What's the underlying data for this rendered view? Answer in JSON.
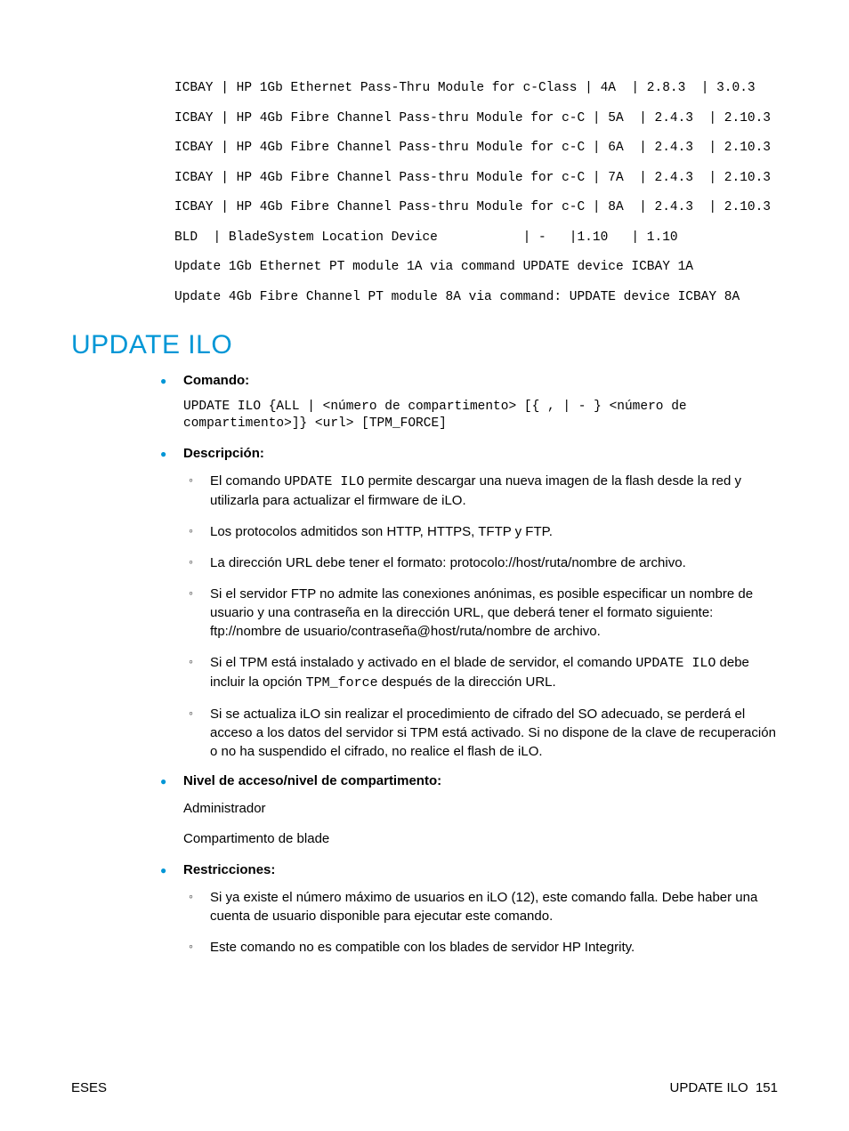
{
  "mono_lines": [
    "ICBAY | HP 1Gb Ethernet Pass-Thru Module for c-Class | 4A  | 2.8.3  | 3.0.3",
    "ICBAY | HP 4Gb Fibre Channel Pass-thru Module for c-C | 5A  | 2.4.3  | 2.10.3",
    "ICBAY | HP 4Gb Fibre Channel Pass-thru Module for c-C | 6A  | 2.4.3  | 2.10.3",
    "ICBAY | HP 4Gb Fibre Channel Pass-thru Module for c-C | 7A  | 2.4.3  | 2.10.3",
    "ICBAY | HP 4Gb Fibre Channel Pass-thru Module for c-C | 8A  | 2.4.3  | 2.10.3",
    "BLD  | BladeSystem Location Device           | -   |1.10   | 1.10",
    "Update 1Gb Ethernet PT module 1A via command UPDATE device ICBAY 1A",
    "Update 4Gb Fibre Channel PT module 8A via command: UPDATE device ICBAY 8A"
  ],
  "section_title": "UPDATE ILO",
  "bullets": {
    "comando": {
      "label": "Comando:",
      "syntax": "UPDATE ILO {ALL | <número de compartimento> [{ , | - } <número de compartimento>]} <url> [TPM_FORCE]"
    },
    "descripcion": {
      "label": "Descripción:",
      "items": {
        "d0_pre": "El comando ",
        "d0_code": "UPDATE ILO",
        "d0_post": " permite descargar una nueva imagen de la flash desde la red y utilizarla para actualizar el firmware de iLO.",
        "d1": "Los protocolos admitidos son HTTP, HTTPS, TFTP y FTP.",
        "d2": "La dirección URL debe tener el formato: protocolo://host/ruta/nombre de archivo.",
        "d3": "Si el servidor FTP no admite las conexiones anónimas, es posible especificar un nombre de usuario y una contraseña en la dirección URL, que deberá tener el formato siguiente: ftp://nombre de usuario/contraseña@host/ruta/nombre de archivo.",
        "d4_pre": "Si el TPM está instalado y activado en el blade de servidor, el comando ",
        "d4_code1": "UPDATE ILO",
        "d4_mid": " debe incluir la opción ",
        "d4_code2": "TPM_force",
        "d4_post": " después de la dirección URL.",
        "d5": "Si se actualiza iLO sin realizar el procedimiento de cifrado del SO adecuado, se perderá el acceso a los datos del servidor si TPM está activado. Si no dispone de la clave de recuperación o no ha suspendido el cifrado, no realice el flash de iLO."
      }
    },
    "nivel": {
      "label": "Nivel de acceso/nivel de compartimento:",
      "line1": "Administrador",
      "line2": "Compartimento de blade"
    },
    "restricciones": {
      "label": "Restricciones:",
      "items": {
        "r0": "Si ya existe el número máximo de usuarios en iLO (12), este comando falla. Debe haber una cuenta de usuario disponible para ejecutar este comando.",
        "r1": "Este comando no es compatible con los blades de servidor HP Integrity."
      }
    }
  },
  "footer": {
    "left": "ESES",
    "right_label": "UPDATE ILO",
    "page_number": "151"
  }
}
